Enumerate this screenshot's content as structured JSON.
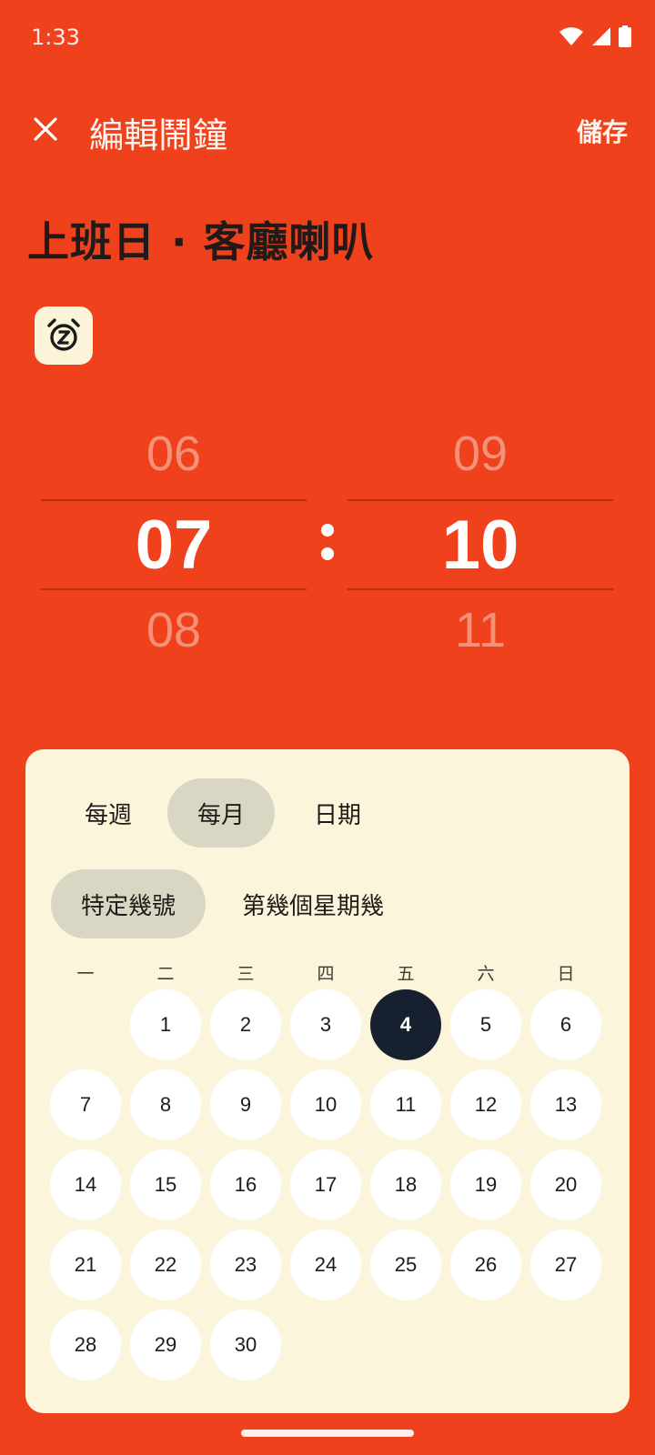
{
  "status": {
    "time": "1:33"
  },
  "header": {
    "title": "編輯鬧鐘",
    "save_label": "儲存"
  },
  "alarm": {
    "name": "上班日 · 客廳喇叭"
  },
  "picker": {
    "hour": {
      "prev": "06",
      "current": "07",
      "next": "08"
    },
    "minute": {
      "prev": "09",
      "current": "10",
      "next": "11"
    }
  },
  "repeat": {
    "frequency_tabs": [
      {
        "label": "每週",
        "selected": false
      },
      {
        "label": "每月",
        "selected": true
      },
      {
        "label": "日期",
        "selected": false
      }
    ],
    "mode_tabs": [
      {
        "label": "特定幾號",
        "selected": true
      },
      {
        "label": "第幾個星期幾",
        "selected": false
      }
    ],
    "weekdays": [
      "一",
      "二",
      "三",
      "四",
      "五",
      "六",
      "日"
    ],
    "days": [
      "1",
      "2",
      "3",
      "4",
      "5",
      "6",
      "7",
      "8",
      "9",
      "10",
      "11",
      "12",
      "13",
      "14",
      "15",
      "16",
      "17",
      "18",
      "19",
      "20",
      "21",
      "22",
      "23",
      "24",
      "25",
      "26",
      "27",
      "28",
      "29",
      "30"
    ],
    "selected_day": "4",
    "first_day_column": 2
  },
  "colors": {
    "background": "#EF411B",
    "card": "#FBF5DB",
    "selected_chip": "#D9D7C4",
    "selected_day": "#17202E"
  }
}
